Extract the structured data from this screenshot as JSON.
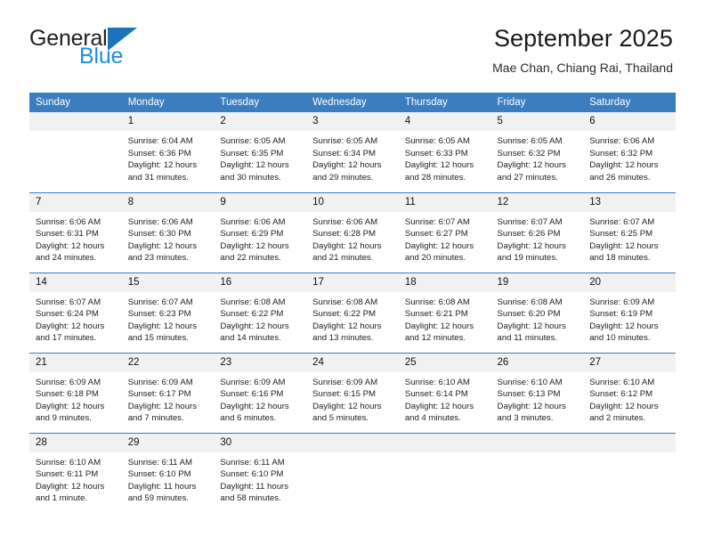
{
  "brand": {
    "name_part1": "General",
    "name_part2": "Blue",
    "logo_icon": "triangle-logo-icon"
  },
  "header": {
    "title": "September 2025",
    "subtitle": "Mae Chan, Chiang Rai, Thailand"
  },
  "colors": {
    "header_blue": "#3b7dbf",
    "brand_blue": "#1b8fe0",
    "logo_blue": "#1b74ba",
    "daynum_band": "#f1f1f1",
    "text": "#222222"
  },
  "calendar": {
    "weekday_headers": [
      "Sunday",
      "Monday",
      "Tuesday",
      "Wednesday",
      "Thursday",
      "Friday",
      "Saturday"
    ],
    "weeks": [
      [
        {
          "day": "",
          "info": "",
          "blank": true
        },
        {
          "day": "1",
          "info": "Sunrise: 6:04 AM\nSunset: 6:36 PM\nDaylight: 12 hours\nand 31 minutes."
        },
        {
          "day": "2",
          "info": "Sunrise: 6:05 AM\nSunset: 6:35 PM\nDaylight: 12 hours\nand 30 minutes."
        },
        {
          "day": "3",
          "info": "Sunrise: 6:05 AM\nSunset: 6:34 PM\nDaylight: 12 hours\nand 29 minutes."
        },
        {
          "day": "4",
          "info": "Sunrise: 6:05 AM\nSunset: 6:33 PM\nDaylight: 12 hours\nand 28 minutes."
        },
        {
          "day": "5",
          "info": "Sunrise: 6:05 AM\nSunset: 6:32 PM\nDaylight: 12 hours\nand 27 minutes."
        },
        {
          "day": "6",
          "info": "Sunrise: 6:06 AM\nSunset: 6:32 PM\nDaylight: 12 hours\nand 26 minutes."
        }
      ],
      [
        {
          "day": "7",
          "info": "Sunrise: 6:06 AM\nSunset: 6:31 PM\nDaylight: 12 hours\nand 24 minutes."
        },
        {
          "day": "8",
          "info": "Sunrise: 6:06 AM\nSunset: 6:30 PM\nDaylight: 12 hours\nand 23 minutes."
        },
        {
          "day": "9",
          "info": "Sunrise: 6:06 AM\nSunset: 6:29 PM\nDaylight: 12 hours\nand 22 minutes."
        },
        {
          "day": "10",
          "info": "Sunrise: 6:06 AM\nSunset: 6:28 PM\nDaylight: 12 hours\nand 21 minutes."
        },
        {
          "day": "11",
          "info": "Sunrise: 6:07 AM\nSunset: 6:27 PM\nDaylight: 12 hours\nand 20 minutes."
        },
        {
          "day": "12",
          "info": "Sunrise: 6:07 AM\nSunset: 6:26 PM\nDaylight: 12 hours\nand 19 minutes."
        },
        {
          "day": "13",
          "info": "Sunrise: 6:07 AM\nSunset: 6:25 PM\nDaylight: 12 hours\nand 18 minutes."
        }
      ],
      [
        {
          "day": "14",
          "info": "Sunrise: 6:07 AM\nSunset: 6:24 PM\nDaylight: 12 hours\nand 17 minutes."
        },
        {
          "day": "15",
          "info": "Sunrise: 6:07 AM\nSunset: 6:23 PM\nDaylight: 12 hours\nand 15 minutes."
        },
        {
          "day": "16",
          "info": "Sunrise: 6:08 AM\nSunset: 6:22 PM\nDaylight: 12 hours\nand 14 minutes."
        },
        {
          "day": "17",
          "info": "Sunrise: 6:08 AM\nSunset: 6:22 PM\nDaylight: 12 hours\nand 13 minutes."
        },
        {
          "day": "18",
          "info": "Sunrise: 6:08 AM\nSunset: 6:21 PM\nDaylight: 12 hours\nand 12 minutes."
        },
        {
          "day": "19",
          "info": "Sunrise: 6:08 AM\nSunset: 6:20 PM\nDaylight: 12 hours\nand 11 minutes."
        },
        {
          "day": "20",
          "info": "Sunrise: 6:09 AM\nSunset: 6:19 PM\nDaylight: 12 hours\nand 10 minutes."
        }
      ],
      [
        {
          "day": "21",
          "info": "Sunrise: 6:09 AM\nSunset: 6:18 PM\nDaylight: 12 hours\nand 9 minutes."
        },
        {
          "day": "22",
          "info": "Sunrise: 6:09 AM\nSunset: 6:17 PM\nDaylight: 12 hours\nand 7 minutes."
        },
        {
          "day": "23",
          "info": "Sunrise: 6:09 AM\nSunset: 6:16 PM\nDaylight: 12 hours\nand 6 minutes."
        },
        {
          "day": "24",
          "info": "Sunrise: 6:09 AM\nSunset: 6:15 PM\nDaylight: 12 hours\nand 5 minutes."
        },
        {
          "day": "25",
          "info": "Sunrise: 6:10 AM\nSunset: 6:14 PM\nDaylight: 12 hours\nand 4 minutes."
        },
        {
          "day": "26",
          "info": "Sunrise: 6:10 AM\nSunset: 6:13 PM\nDaylight: 12 hours\nand 3 minutes."
        },
        {
          "day": "27",
          "info": "Sunrise: 6:10 AM\nSunset: 6:12 PM\nDaylight: 12 hours\nand 2 minutes."
        }
      ],
      [
        {
          "day": "28",
          "info": "Sunrise: 6:10 AM\nSunset: 6:11 PM\nDaylight: 12 hours\nand 1 minute."
        },
        {
          "day": "29",
          "info": "Sunrise: 6:11 AM\nSunset: 6:10 PM\nDaylight: 11 hours\nand 59 minutes."
        },
        {
          "day": "30",
          "info": "Sunrise: 6:11 AM\nSunset: 6:10 PM\nDaylight: 11 hours\nand 58 minutes."
        },
        {
          "day": "",
          "info": "",
          "blank": true
        },
        {
          "day": "",
          "info": "",
          "blank": true
        },
        {
          "day": "",
          "info": "",
          "blank": true
        },
        {
          "day": "",
          "info": "",
          "blank": true
        }
      ]
    ]
  }
}
